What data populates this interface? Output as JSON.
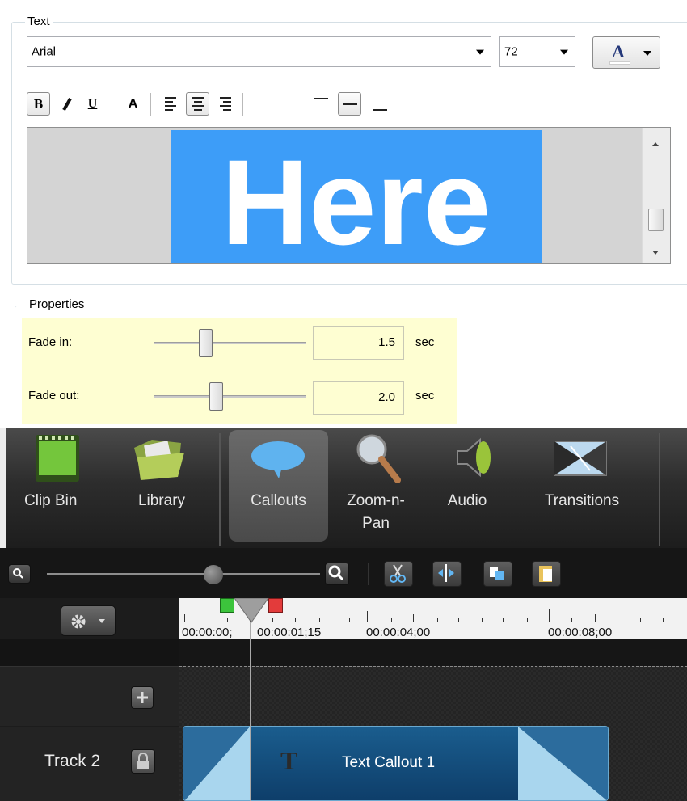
{
  "text_group": {
    "title": "Text",
    "font": "Arial",
    "size": "72",
    "color_button": "A",
    "format_buttons": {
      "bold": "B",
      "italic": "I",
      "underline": "U",
      "effect": "A"
    },
    "preview_text": "Here"
  },
  "properties_group": {
    "title": "Properties",
    "fade_in": {
      "label": "Fade in:",
      "value": "1.5",
      "unit": "sec",
      "slider_fraction": 0.32
    },
    "fade_out": {
      "label": "Fade out:",
      "value": "2.0",
      "unit": "sec",
      "slider_fraction": 0.4
    }
  },
  "tools": [
    {
      "label": "Clip Bin",
      "icon": "film-icon"
    },
    {
      "label": "Library",
      "icon": "folder-icon"
    },
    {
      "label": "Callouts",
      "icon": "speech-bubble-icon",
      "selected": true
    },
    {
      "label": "Zoom-n-Pan",
      "icon": "magnifier-icon"
    },
    {
      "label": "Audio",
      "icon": "speaker-icon"
    },
    {
      "label": "Transitions",
      "icon": "transitions-icon"
    }
  ],
  "timeline": {
    "timecodes": [
      "00:00:00;",
      "00:00:01;15",
      "00:00:04;00",
      "00:00:08;00"
    ],
    "track_name": "Track 2",
    "clip_label": "Text Callout 1",
    "clip_icon_letter": "T"
  },
  "colors": {
    "preview_bg": "#3d9df8",
    "property_highlight": "#fefed2",
    "clip_blue": "#114a7a"
  }
}
